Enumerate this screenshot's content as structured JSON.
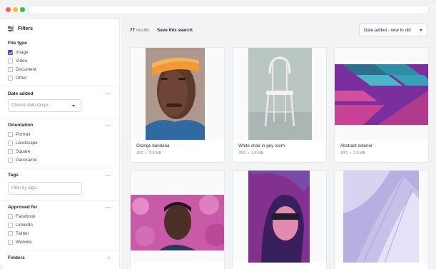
{
  "filters": {
    "title": "Filters"
  },
  "file_type": {
    "title": "File type",
    "options": [
      {
        "label": "Image",
        "checked": true
      },
      {
        "label": "Video",
        "checked": false
      },
      {
        "label": "Document",
        "checked": false
      },
      {
        "label": "Other",
        "checked": false
      }
    ]
  },
  "date_added": {
    "title": "Date added",
    "placeholder": "Choose date range...",
    "toggle": "—"
  },
  "orientation": {
    "title": "Orientation",
    "toggle": "—",
    "options": [
      {
        "label": "Portrait",
        "checked": false
      },
      {
        "label": "Landscape",
        "checked": false
      },
      {
        "label": "Square",
        "checked": false
      },
      {
        "label": "Panoramic",
        "checked": false
      }
    ]
  },
  "tags": {
    "title": "Tags",
    "placeholder": "Filter by tags...",
    "toggle": "—"
  },
  "approved_for": {
    "title": "Approved for",
    "toggle": "—",
    "options": [
      {
        "label": "Facebook",
        "checked": false
      },
      {
        "label": "LinkedIn",
        "checked": false
      },
      {
        "label": "Twitter",
        "checked": false
      },
      {
        "label": "Website",
        "checked": false
      }
    ]
  },
  "folders": {
    "title": "Folders",
    "toggle": "+"
  },
  "toolbar": {
    "count": "77",
    "count_suffix": " results",
    "save_search": "Save this search",
    "sort_value": "Date added - new to old"
  },
  "cards": [
    {
      "title": "Orange bandana",
      "format": "JPG",
      "size": "2.8 MB"
    },
    {
      "title": "White chair in gey room",
      "format": "JPG",
      "size": "2.8 MB"
    },
    {
      "title": "Abstract exterior",
      "format": "JPG",
      "size": "2.8 MB"
    },
    {
      "title": "",
      "format": "",
      "size": ""
    },
    {
      "title": "",
      "format": "",
      "size": ""
    },
    {
      "title": "",
      "format": "",
      "size": ""
    }
  ],
  "colors": {
    "accent": "#5b3fd9",
    "window_red": "#ff5f57",
    "window_yellow": "#febc2e",
    "window_green": "#28c840"
  }
}
